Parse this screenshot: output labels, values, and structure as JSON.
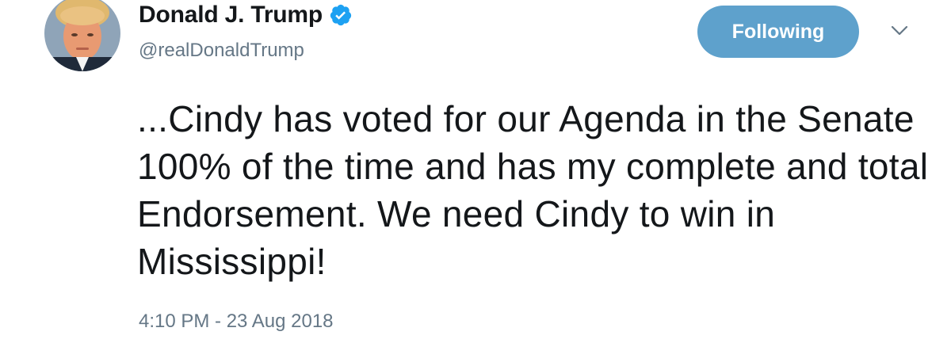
{
  "user": {
    "display_name": "Donald J. Trump",
    "handle": "@realDonaldTrump",
    "verified": true
  },
  "follow_button": {
    "label": "Following"
  },
  "tweet": {
    "text": "...Cindy has voted for our Agenda in the Senate 100% of the time and has my complete and total Endorsement. We need Cindy to win in Mississippi!",
    "timestamp": "4:10 PM - 23 Aug 2018"
  },
  "colors": {
    "accent": "#5ea1cc",
    "verified_badge": "#1da1f2",
    "secondary_text": "#657786",
    "primary_text": "#14171a"
  },
  "icons": {
    "verified": "verified-badge-icon",
    "menu": "chevron-down-icon"
  }
}
